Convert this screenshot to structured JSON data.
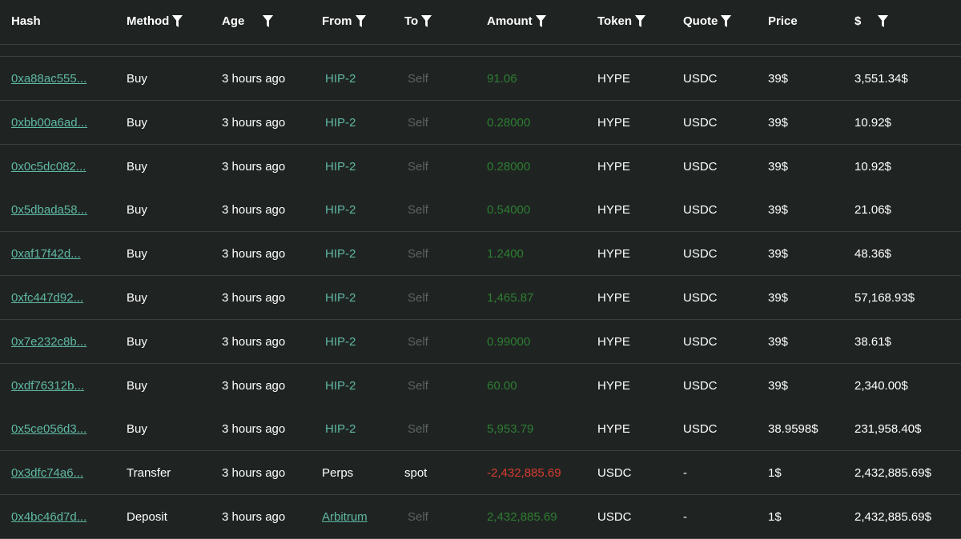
{
  "columns": [
    {
      "label": "Hash",
      "filter": false
    },
    {
      "label": "Method",
      "filter": true
    },
    {
      "label": "Age",
      "filter": true
    },
    {
      "label": "From",
      "filter": true
    },
    {
      "label": "To",
      "filter": true
    },
    {
      "label": "Amount",
      "filter": true
    },
    {
      "label": "Token",
      "filter": true
    },
    {
      "label": "Quote",
      "filter": true
    },
    {
      "label": "Price",
      "filter": false
    },
    {
      "label": "$",
      "filter": true
    }
  ],
  "colors": {
    "background": "#1f2422",
    "link": "#5fb8a3",
    "positive": "#2e7d32",
    "negative": "#d93b30",
    "muted": "#5c6360"
  },
  "rows": [
    {
      "hash": "0xa88ac555...",
      "method": "Buy",
      "age": "3 hours ago",
      "from": "HIP-2",
      "from_type": "hip",
      "to": "Self",
      "to_type": "self",
      "amount": "91.06",
      "amount_type": "pos",
      "token": "HYPE",
      "quote": "USDC",
      "price": "39$",
      "usd": "3,551.34$"
    },
    {
      "hash": "0xbb00a6ad...",
      "method": "Buy",
      "age": "3 hours ago",
      "from": "HIP-2",
      "from_type": "hip",
      "to": "Self",
      "to_type": "self",
      "amount": "0.28000",
      "amount_type": "pos",
      "token": "HYPE",
      "quote": "USDC",
      "price": "39$",
      "usd": "10.92$"
    },
    {
      "hash": "0x0c5dc082...",
      "method": "Buy",
      "age": "3 hours ago",
      "from": "HIP-2",
      "from_type": "hip",
      "to": "Self",
      "to_type": "self",
      "amount": "0.28000",
      "amount_type": "pos",
      "token": "HYPE",
      "quote": "USDC",
      "price": "39$",
      "usd": "10.92$"
    },
    {
      "hash": "0x5dbada58...",
      "method": "Buy",
      "age": "3 hours ago",
      "from": "HIP-2",
      "from_type": "hip",
      "to": "Self",
      "to_type": "self",
      "amount": "0.54000",
      "amount_type": "pos",
      "token": "HYPE",
      "quote": "USDC",
      "price": "39$",
      "usd": "21.06$"
    },
    {
      "hash": "0xaf17f42d...",
      "method": "Buy",
      "age": "3 hours ago",
      "from": "HIP-2",
      "from_type": "hip",
      "to": "Self",
      "to_type": "self",
      "amount": "1.2400",
      "amount_type": "pos",
      "token": "HYPE",
      "quote": "USDC",
      "price": "39$",
      "usd": "48.36$"
    },
    {
      "hash": "0xfc447d92...",
      "method": "Buy",
      "age": "3 hours ago",
      "from": "HIP-2",
      "from_type": "hip",
      "to": "Self",
      "to_type": "self",
      "amount": "1,465.87",
      "amount_type": "pos",
      "token": "HYPE",
      "quote": "USDC",
      "price": "39$",
      "usd": "57,168.93$"
    },
    {
      "hash": "0x7e232c8b...",
      "method": "Buy",
      "age": "3 hours ago",
      "from": "HIP-2",
      "from_type": "hip",
      "to": "Self",
      "to_type": "self",
      "amount": "0.99000",
      "amount_type": "pos",
      "token": "HYPE",
      "quote": "USDC",
      "price": "39$",
      "usd": "38.61$"
    },
    {
      "hash": "0xdf76312b...",
      "method": "Buy",
      "age": "3 hours ago",
      "from": "HIP-2",
      "from_type": "hip",
      "to": "Self",
      "to_type": "self",
      "amount": "60.00",
      "amount_type": "pos",
      "token": "HYPE",
      "quote": "USDC",
      "price": "39$",
      "usd": "2,340.00$"
    },
    {
      "hash": "0x5ce056d3...",
      "method": "Buy",
      "age": "3 hours ago",
      "from": "HIP-2",
      "from_type": "hip",
      "to": "Self",
      "to_type": "self",
      "amount": "5,953.79",
      "amount_type": "pos",
      "token": "HYPE",
      "quote": "USDC",
      "price": "38.9598$",
      "usd": "231,958.40$"
    },
    {
      "hash": "0x3dfc74a6...",
      "method": "Transfer",
      "age": "3 hours ago",
      "from": "Perps",
      "from_type": "plain",
      "to": "spot",
      "to_type": "plain",
      "amount": "-2,432,885.69",
      "amount_type": "neg",
      "token": "USDC",
      "quote": "-",
      "price": "1$",
      "usd": "2,432,885.69$"
    },
    {
      "hash": "0x4bc46d7d...",
      "method": "Deposit",
      "age": "3 hours ago",
      "from": "Arbitrum",
      "from_type": "link",
      "to": "Self",
      "to_type": "self",
      "amount": "2,432,885.69",
      "amount_type": "pos",
      "token": "USDC",
      "quote": "-",
      "price": "1$",
      "usd": "2,432,885.69$"
    }
  ]
}
